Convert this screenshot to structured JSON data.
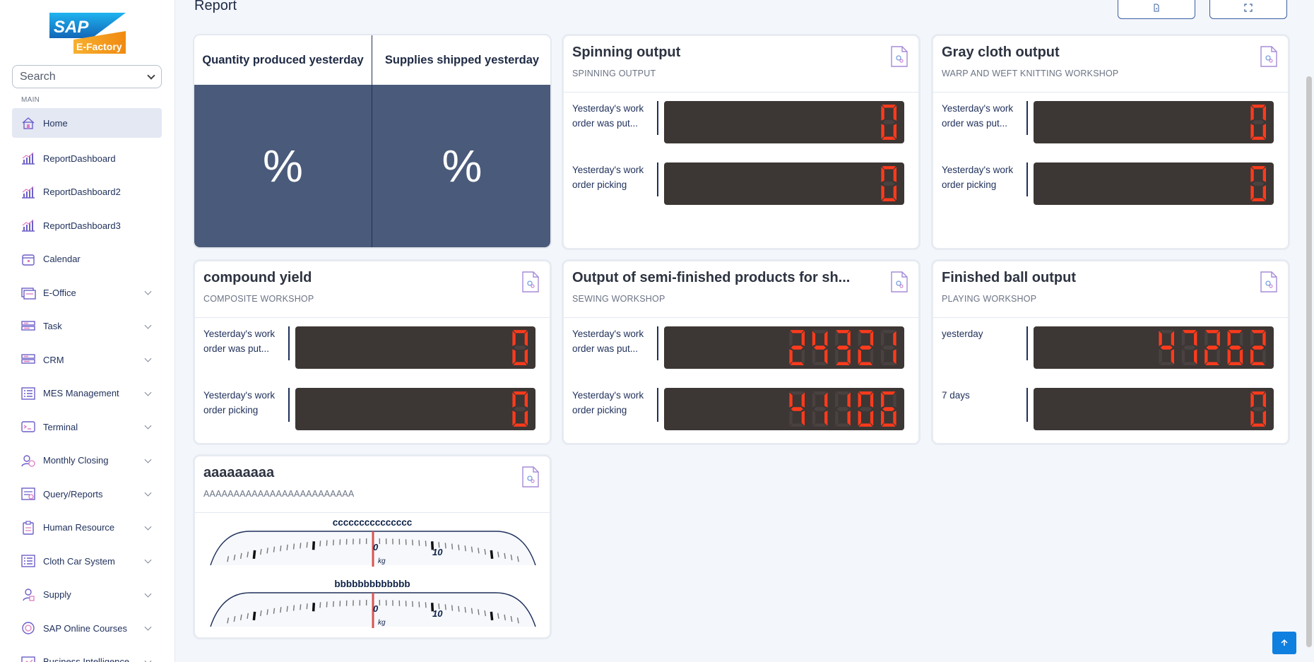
{
  "app": {
    "logo_top": "SAP",
    "logo_bottom": "E-Factory"
  },
  "sidebar": {
    "search_placeholder": "Search",
    "section_label": "MAIN",
    "items": [
      {
        "label": "Home",
        "icon": "home-icon",
        "active": true,
        "expandable": false
      },
      {
        "label": "ReportDashboard",
        "icon": "chart-icon",
        "expandable": false
      },
      {
        "label": "ReportDashboard2",
        "icon": "chart-icon",
        "expandable": false
      },
      {
        "label": "ReportDashboard3",
        "icon": "chart-icon",
        "expandable": false
      },
      {
        "label": "Calendar",
        "icon": "calendar-icon",
        "expandable": false
      },
      {
        "label": "E-Office",
        "icon": "office-icon",
        "expandable": true
      },
      {
        "label": "Task",
        "icon": "task-icon",
        "expandable": true
      },
      {
        "label": "CRM",
        "icon": "crm-icon",
        "expandable": true
      },
      {
        "label": "MES Management",
        "icon": "list-icon",
        "expandable": true
      },
      {
        "label": "Terminal",
        "icon": "terminal-icon",
        "expandable": true
      },
      {
        "label": "Monthly Closing",
        "icon": "user-clock-icon",
        "expandable": true
      },
      {
        "label": "Query/Reports",
        "icon": "report-icon",
        "expandable": true
      },
      {
        "label": "Human Resource",
        "icon": "clipboard-icon",
        "expandable": true
      },
      {
        "label": "Cloth Car System",
        "icon": "list-icon",
        "expandable": true
      },
      {
        "label": "Supply",
        "icon": "supply-icon",
        "expandable": true
      },
      {
        "label": "SAP Online Courses",
        "icon": "course-icon",
        "expandable": true
      },
      {
        "label": "Business Intelligence",
        "icon": "bi-icon",
        "expandable": true
      }
    ]
  },
  "header": {
    "title": "Report"
  },
  "qty_card": {
    "col1_title": "Quantity produced yesterday",
    "col2_title": "Supplies shipped yesterday",
    "col1_value": "%",
    "col2_value": "%"
  },
  "cards": [
    {
      "title": "Spinning output",
      "subtitle": "SPINNING OUTPUT",
      "rows": [
        {
          "label": "Yesterday's work order was put...",
          "value": "0"
        },
        {
          "label": "Yesterday's work order picking",
          "value": "0"
        }
      ]
    },
    {
      "title": "Gray cloth output",
      "subtitle": "WARP AND WEFT KNITTING WORKSHOP",
      "rows": [
        {
          "label": "Yesterday's work order was put...",
          "value": "0"
        },
        {
          "label": "Yesterday's work order picking",
          "value": "0"
        }
      ]
    },
    {
      "title": "compound yield",
      "subtitle": "COMPOSITE WORKSHOP",
      "rows": [
        {
          "label": "Yesterday's work order was put...",
          "value": "0"
        },
        {
          "label": "Yesterday's work order picking",
          "value": "0"
        }
      ]
    },
    {
      "title": "Output of semi-finished products for sh...",
      "subtitle": "SEWING WORKSHOP",
      "rows": [
        {
          "label": "Yesterday's work order was put...",
          "value": "24321"
        },
        {
          "label": "Yesterday's work order picking",
          "value": "41106"
        }
      ]
    },
    {
      "title": "Finished ball output",
      "subtitle": "PLAYING WORKSHOP",
      "rows": [
        {
          "label": "yesterday",
          "value": "47262"
        },
        {
          "label": "7 days",
          "value": "0"
        }
      ]
    }
  ],
  "gauge_card": {
    "title": "aaaaaaaaa",
    "subtitle": "AAAAAAAAAAAAAAAAAAAAAAAAA",
    "gauges": [
      {
        "label": "ccccccccccccccc",
        "zero_label": "0",
        "ten_label": "10",
        "unit": "kg"
      },
      {
        "label": "bbbbbbbbbbbbb",
        "zero_label": "0",
        "ten_label": "10",
        "unit": "kg"
      }
    ]
  },
  "colors": {
    "led_on": "#ff3b1c",
    "led_off": "#4a4240",
    "led_bg": "#3c3634",
    "qty_bg": "#4a5a7a",
    "accent": "#0f7fe0"
  }
}
